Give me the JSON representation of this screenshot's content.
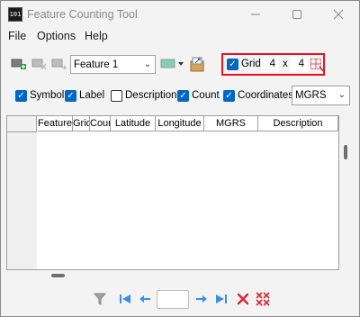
{
  "window": {
    "icon_text": "101",
    "title": "Feature Counting Tool",
    "controls": [
      "minimize-icon",
      "maximize-icon",
      "close-icon"
    ]
  },
  "menu": {
    "items": [
      "File",
      "Options",
      "Help"
    ]
  },
  "toolbar": {
    "tools_left": [
      "add-feature-icon",
      "remove-feature-icon",
      "move-feature-icon"
    ],
    "feature_select": {
      "value": "Feature 1"
    },
    "color_picker": {
      "color": "#7fd0b8"
    },
    "export_tool": "export-icon",
    "grid": {
      "checked": true,
      "label": "Grid",
      "rows": "4",
      "times": "x",
      "cols": "4",
      "draw_icon": "draw-grid-icon"
    },
    "highlight_color": "#e81123"
  },
  "options": {
    "symbol": {
      "label": "Symbol",
      "checked": true
    },
    "label": {
      "label": "Label",
      "checked": true
    },
    "description": {
      "label": "Description",
      "checked": false
    },
    "count": {
      "label": "Count",
      "checked": true
    },
    "coordinates": {
      "label": "Coordinates",
      "checked": true
    },
    "coord_format": {
      "value": "MGRS"
    }
  },
  "table": {
    "columns": [
      "Feature",
      "Grid",
      "Count",
      "Latitude",
      "Longitude",
      "MGRS",
      "Description"
    ],
    "rows": []
  },
  "navigation": {
    "tools": [
      "filter-icon",
      "first-record-icon",
      "previous-record-icon",
      "next-record-icon",
      "last-record-icon",
      "delete-record-icon",
      "delete-all-icon"
    ],
    "record_value": ""
  }
}
